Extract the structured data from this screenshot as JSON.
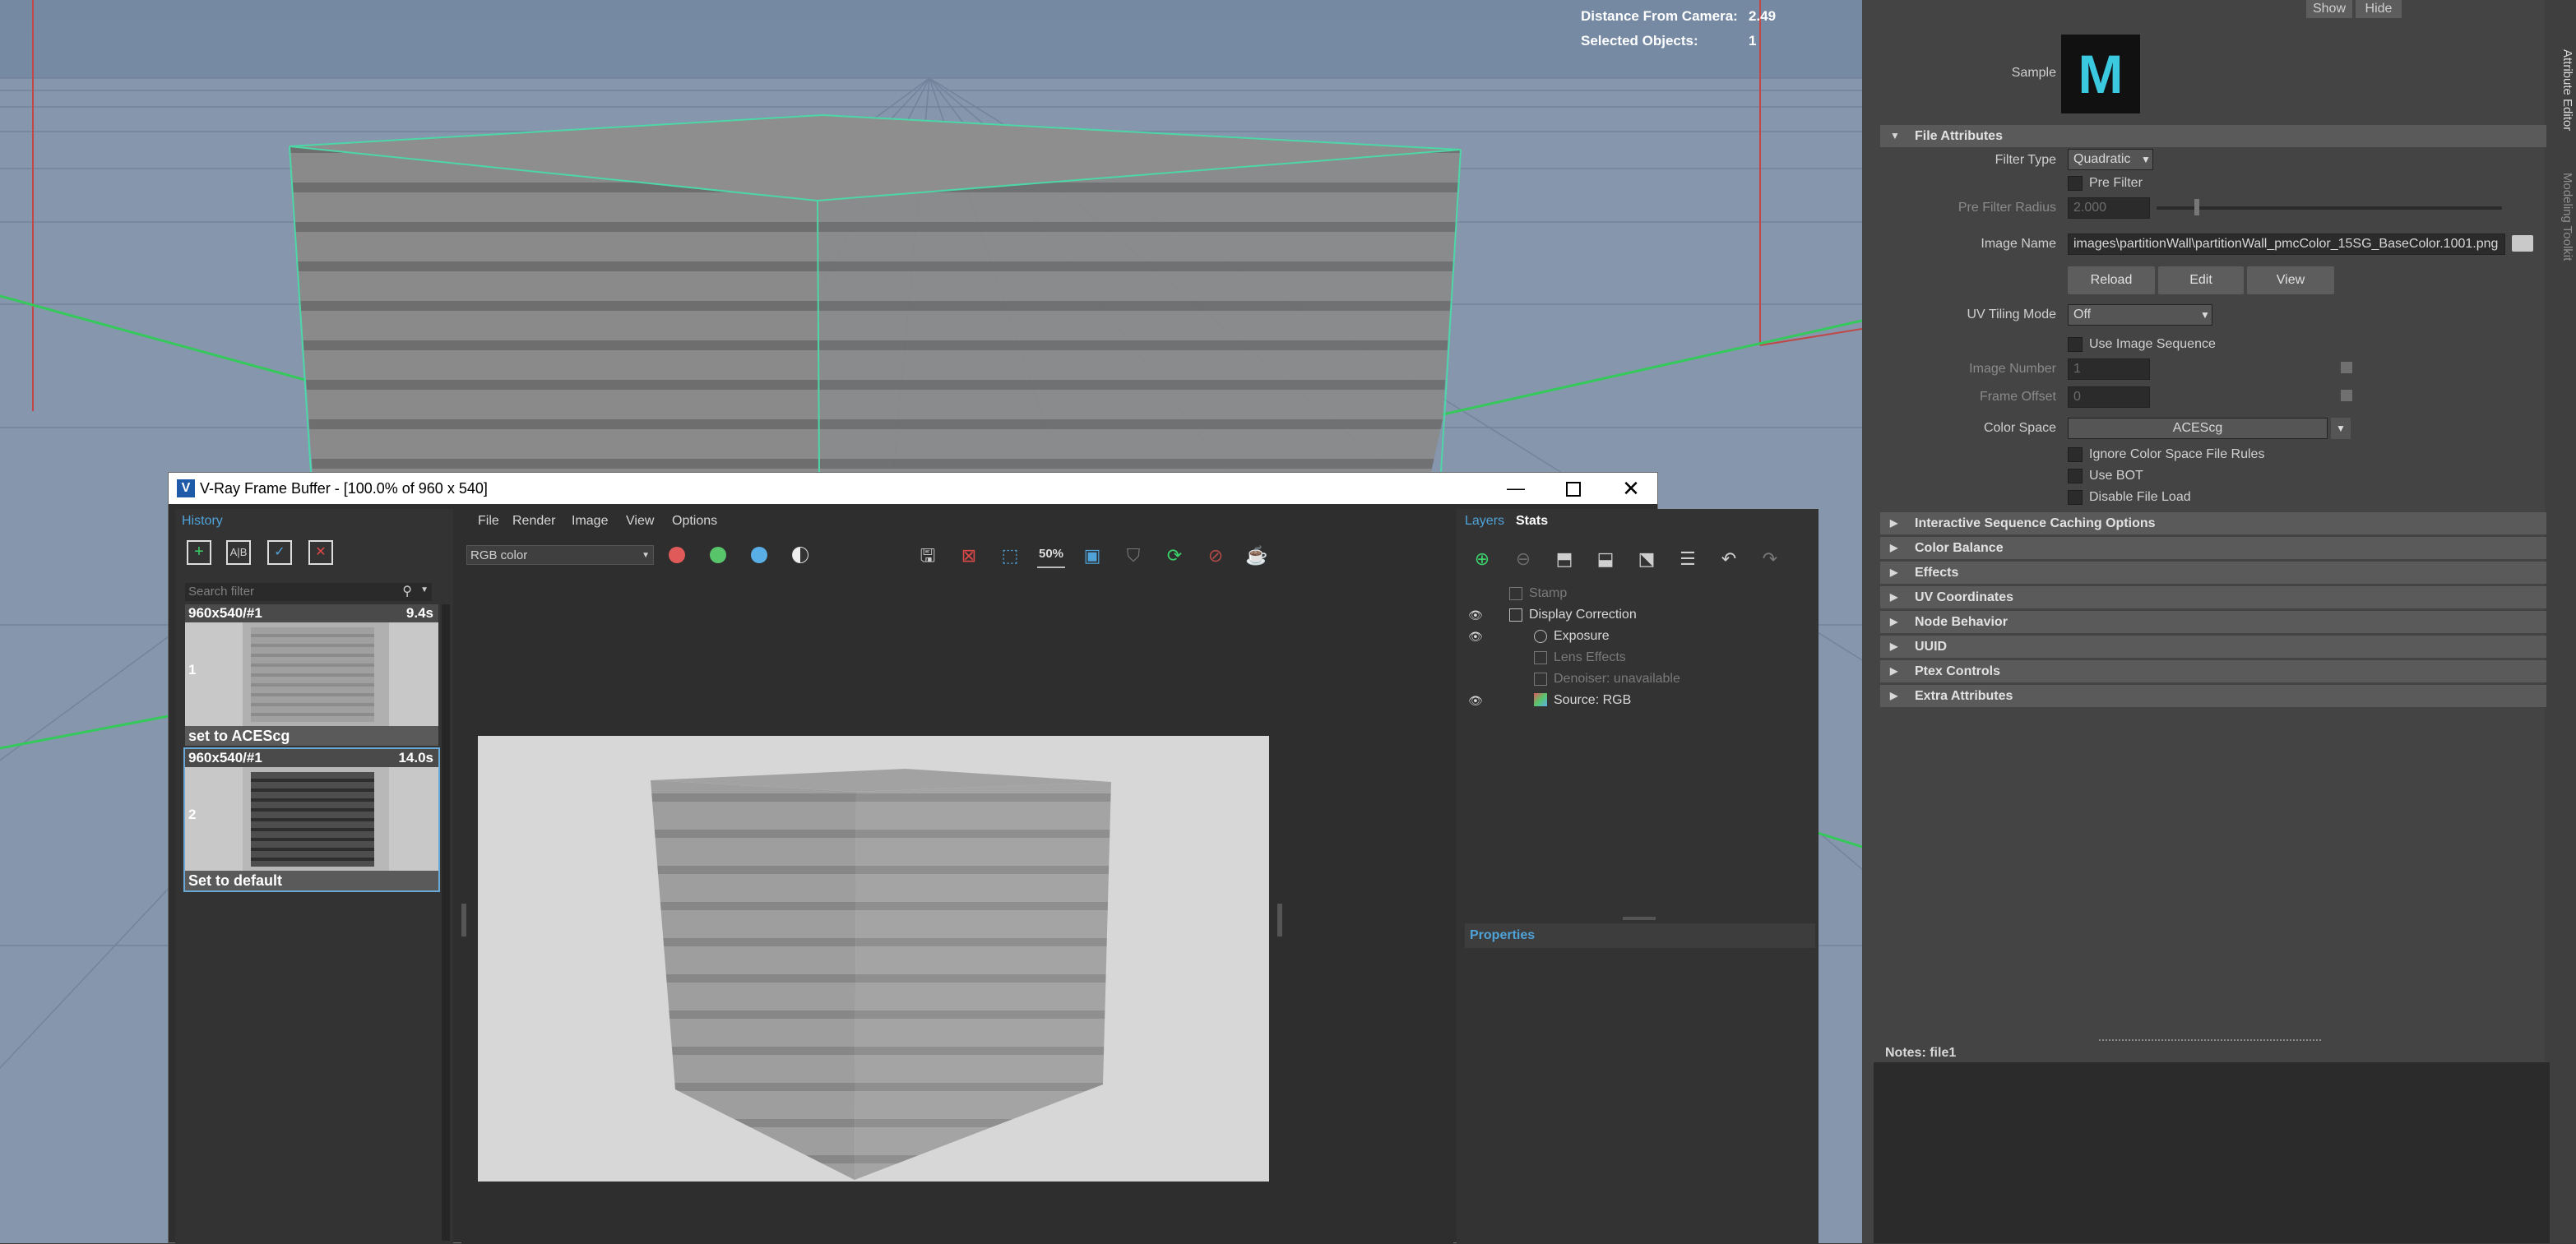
{
  "viewport": {
    "hud": [
      {
        "label": "Distance From Camera:",
        "value": "2.49"
      },
      {
        "label": "Selected Objects:",
        "value": "1"
      }
    ]
  },
  "attribute_editor": {
    "top_buttons": {
      "show": "Show",
      "hide": "Hide"
    },
    "sample_label": "Sample",
    "sample_icon_letter": "M",
    "file_attributes": {
      "section_title": "File Attributes",
      "filter_type_label": "Filter Type",
      "filter_type_value": "Quadratic",
      "pre_filter_label": "Pre Filter",
      "pre_filter_radius_label": "Pre Filter Radius",
      "pre_filter_radius_value": "2.000",
      "image_name_label": "Image Name",
      "image_name_value": "images\\partitionWall\\partitionWall_pmcColor_15SG_BaseColor.1001.png",
      "reload": "Reload",
      "edit": "Edit",
      "view": "View",
      "uv_tiling_mode_label": "UV Tiling Mode",
      "uv_tiling_mode_value": "Off",
      "use_image_sequence_label": "Use Image Sequence",
      "image_number_label": "Image Number",
      "image_number_value": "1",
      "frame_offset_label": "Frame Offset",
      "frame_offset_value": "0",
      "color_space_label": "Color Space",
      "color_space_value": "ACEScg",
      "ignore_cs_rules_label": "Ignore Color Space File Rules",
      "use_bot_label": "Use BOT",
      "disable_file_load_label": "Disable File Load"
    },
    "sections": [
      "Interactive Sequence Caching Options",
      "Color Balance",
      "Effects",
      "UV Coordinates",
      "Node Behavior",
      "UUID",
      "Ptex Controls",
      "Extra Attributes"
    ],
    "notes_label": "Notes:  file1",
    "side_tabs": [
      "Attribute Editor",
      "Modeling Toolkit"
    ]
  },
  "vfb": {
    "title": "V-Ray Frame Buffer - [100.0% of 960 x 540]",
    "history": {
      "title": "History",
      "search_placeholder": "Search filter",
      "items": [
        {
          "res": "960x540/#1",
          "time": "9.4s",
          "index": "1",
          "label": "set to ACEScg"
        },
        {
          "res": "960x540/#1",
          "time": "14.0s",
          "index": "2",
          "label": "Set to default"
        }
      ]
    },
    "menu": [
      "File",
      "Render",
      "Image",
      "View",
      "Options"
    ],
    "channel_value": "RGB color",
    "zoom_label": "50%",
    "layers_tabs": {
      "layers": "Layers",
      "stats": "Stats"
    },
    "layers": [
      {
        "name": "Stamp",
        "dim": true
      },
      {
        "name": "Display Correction",
        "dim": false
      },
      {
        "name": "Exposure",
        "dim": false
      },
      {
        "name": "Lens Effects",
        "dim": true
      },
      {
        "name": "Denoiser: unavailable",
        "dim": true
      },
      {
        "name": "Source: RGB",
        "dim": false
      }
    ],
    "properties_title": "Properties"
  },
  "colors": {
    "accent_blue": "#4fa3d9",
    "selection_green": "#39d27a",
    "viewport_sky": "#7d93ad",
    "viewport_floor": "#8294ab"
  }
}
